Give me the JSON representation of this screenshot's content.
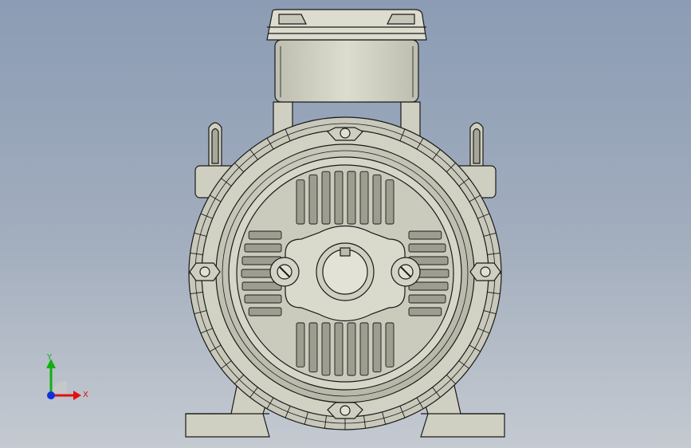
{
  "viewport": {
    "background_top": "#8b9cb4",
    "background_bottom": "#c5cad1"
  },
  "model": {
    "view": "front",
    "body_color": "#d4d4c6",
    "edge_color": "#1a1a1a",
    "shade_color": "#b9b9ab"
  },
  "triad": {
    "x_label": "X",
    "y_label": "Y",
    "x_color": "#e01010",
    "y_color": "#10b010",
    "z_color": "#1030e0"
  }
}
